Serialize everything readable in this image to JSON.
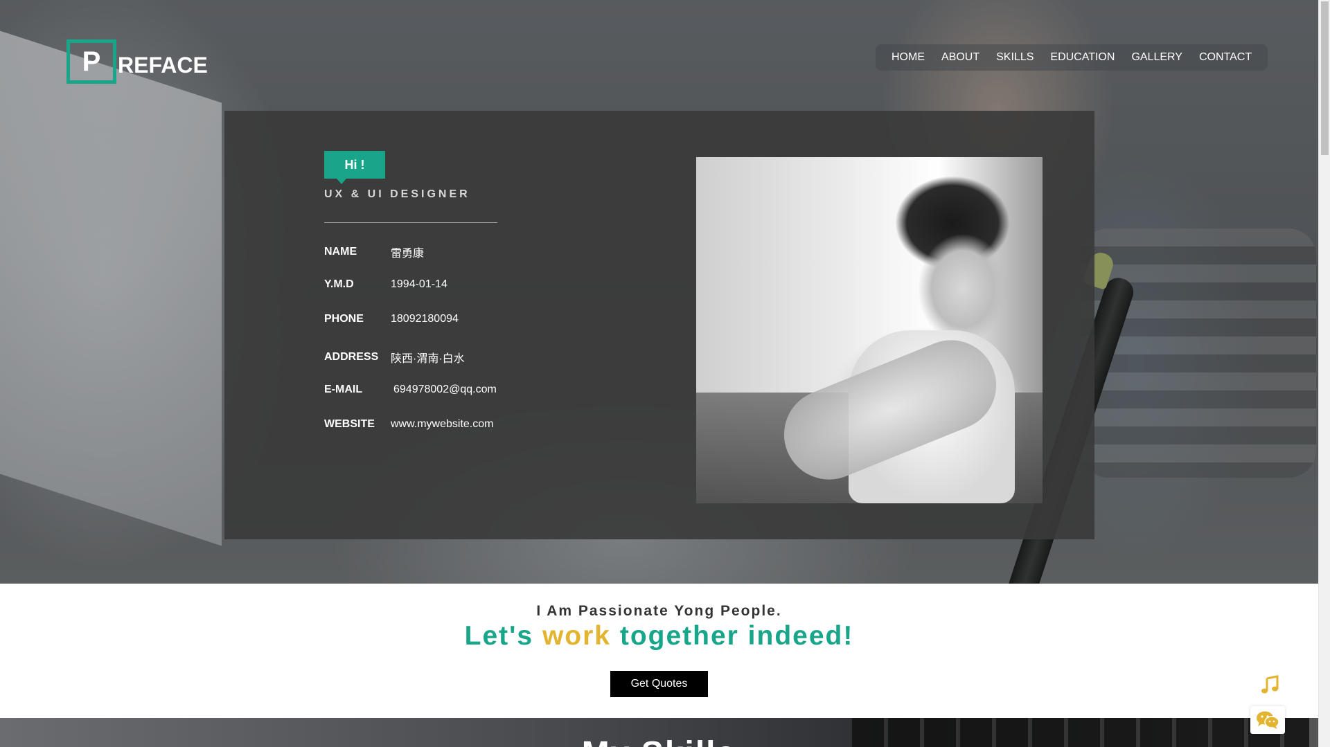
{
  "brand": {
    "logo_letter": "P",
    "logo_text": "REFACE",
    "accent_color": "#18a589",
    "gold_color": "#e3b430"
  },
  "nav": {
    "items": [
      {
        "label": "HOME"
      },
      {
        "label": "ABOUT"
      },
      {
        "label": "SKILLS"
      },
      {
        "label": "EDUCATION"
      },
      {
        "label": "GALLERY"
      },
      {
        "label": "CONTACT"
      }
    ]
  },
  "profile": {
    "greeting": "Hi !",
    "role": "UX & UI DESIGNER",
    "fields": [
      {
        "label": "NAME",
        "value": "雷勇康"
      },
      {
        "label": "Y.M.D",
        "value": "1994-01-14"
      },
      {
        "label": "PHONE",
        "value": "18092180094"
      },
      {
        "label": "ADDRESS",
        "value": "陕西·渭南·白水"
      },
      {
        "label": "E-MAIL",
        "value": "694978002@qq.com"
      },
      {
        "label": "WEBSITE",
        "value": "www.mywebsite.com"
      }
    ],
    "photo": "black-and-white-portrait"
  },
  "band": {
    "subtitle": "I Am Passionate Yong People.",
    "title_part1": "Let's ",
    "title_part2": "work",
    "title_part3": " together indeed!",
    "cta_label": "Get Quotes"
  },
  "next_section": {
    "title_partial": "My Skills"
  },
  "widgets": {
    "music_icon": "music-note-icon",
    "wechat_icon": "wechat-icon"
  }
}
